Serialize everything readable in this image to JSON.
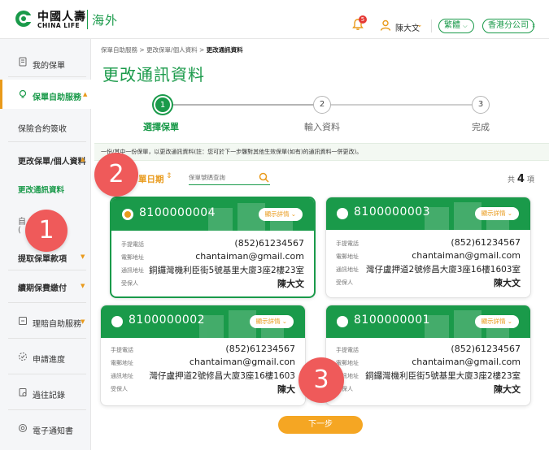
{
  "header": {
    "brand_cn": "中國人壽",
    "brand_en": "CHINA LIFE",
    "brand_sub": "海外",
    "notification_count": "5",
    "user_name": "陳大文",
    "language": "繁體",
    "branch": "香港分公司"
  },
  "sidebar": {
    "items": [
      {
        "label": "我的保單"
      },
      {
        "label": "保單自助服務"
      },
      {
        "label": "保險合約簽收"
      },
      {
        "label": "更改保單/個人資料"
      },
      {
        "label": "更改通訊資料"
      },
      {
        "label": "自"
      },
      {
        "label": "("
      },
      {
        "label": "提取保單款項"
      },
      {
        "label": "續期保費繳付"
      },
      {
        "label": "理賠自助服務"
      },
      {
        "label": "申請進度"
      },
      {
        "label": "過往記錄"
      },
      {
        "label": "電子通知書"
      }
    ]
  },
  "breadcrumb": {
    "items": [
      "保單自助服務",
      "更改保單/個人資料",
      "更改通訊資料"
    ]
  },
  "page_title": "更改通訊資料",
  "stepper": {
    "steps": [
      {
        "num": "1",
        "label": "選擇保單"
      },
      {
        "num": "2",
        "label": "輸入資料"
      },
      {
        "num": "3",
        "label": "完成"
      }
    ]
  },
  "notice": "一份/其中一份保單，以更改通訊資料(註：您可於下一步驟對其他生效保單(如有)的通訊資料一併更改)。",
  "filter": {
    "sort_label": "單日期",
    "search_placeholder": "保單號碼查詢",
    "total_prefix": "共",
    "total_count": "4",
    "total_suffix": "項"
  },
  "field_labels": {
    "phone": "手提電話",
    "email": "電郵地址",
    "address": "通訊地址",
    "insured": "受保人"
  },
  "detail_label": "顯示詳情",
  "policies": [
    {
      "no": "8100000004",
      "phone": "(852)61234567",
      "email": "chantaiman@gmail.com",
      "address": "銅鑼灣機利臣街5號基里大廈3座2樓23室",
      "insured": "陳大文"
    },
    {
      "no": "8100000003",
      "phone": "(852)61234567",
      "email": "chantaiman@gmail.com",
      "address": "灣仔盧押道2號修昌大廈3座16樓1603室",
      "insured": "陳大文"
    },
    {
      "no": "8100000002",
      "phone": "(852)61234567",
      "email": "chantaiman@gmail.con",
      "address": "灣仔盧押道2號修昌大廈3座16樓1603",
      "insured": "陳大"
    },
    {
      "no": "8100000001",
      "phone": "(852)61234567",
      "email": "chantaiman@gmail.com",
      "address": "銅鑼灣機利臣街5號基里大廈3座2樓23室",
      "insured": "陳大文"
    }
  ],
  "next_button": "下一步",
  "callouts": [
    "1",
    "2",
    "3"
  ],
  "colors": {
    "brand_green": "#1a9a4a",
    "accent_orange": "#e99a1b",
    "button_orange": "#f5a623",
    "callout_red": "#ef5a5a"
  }
}
